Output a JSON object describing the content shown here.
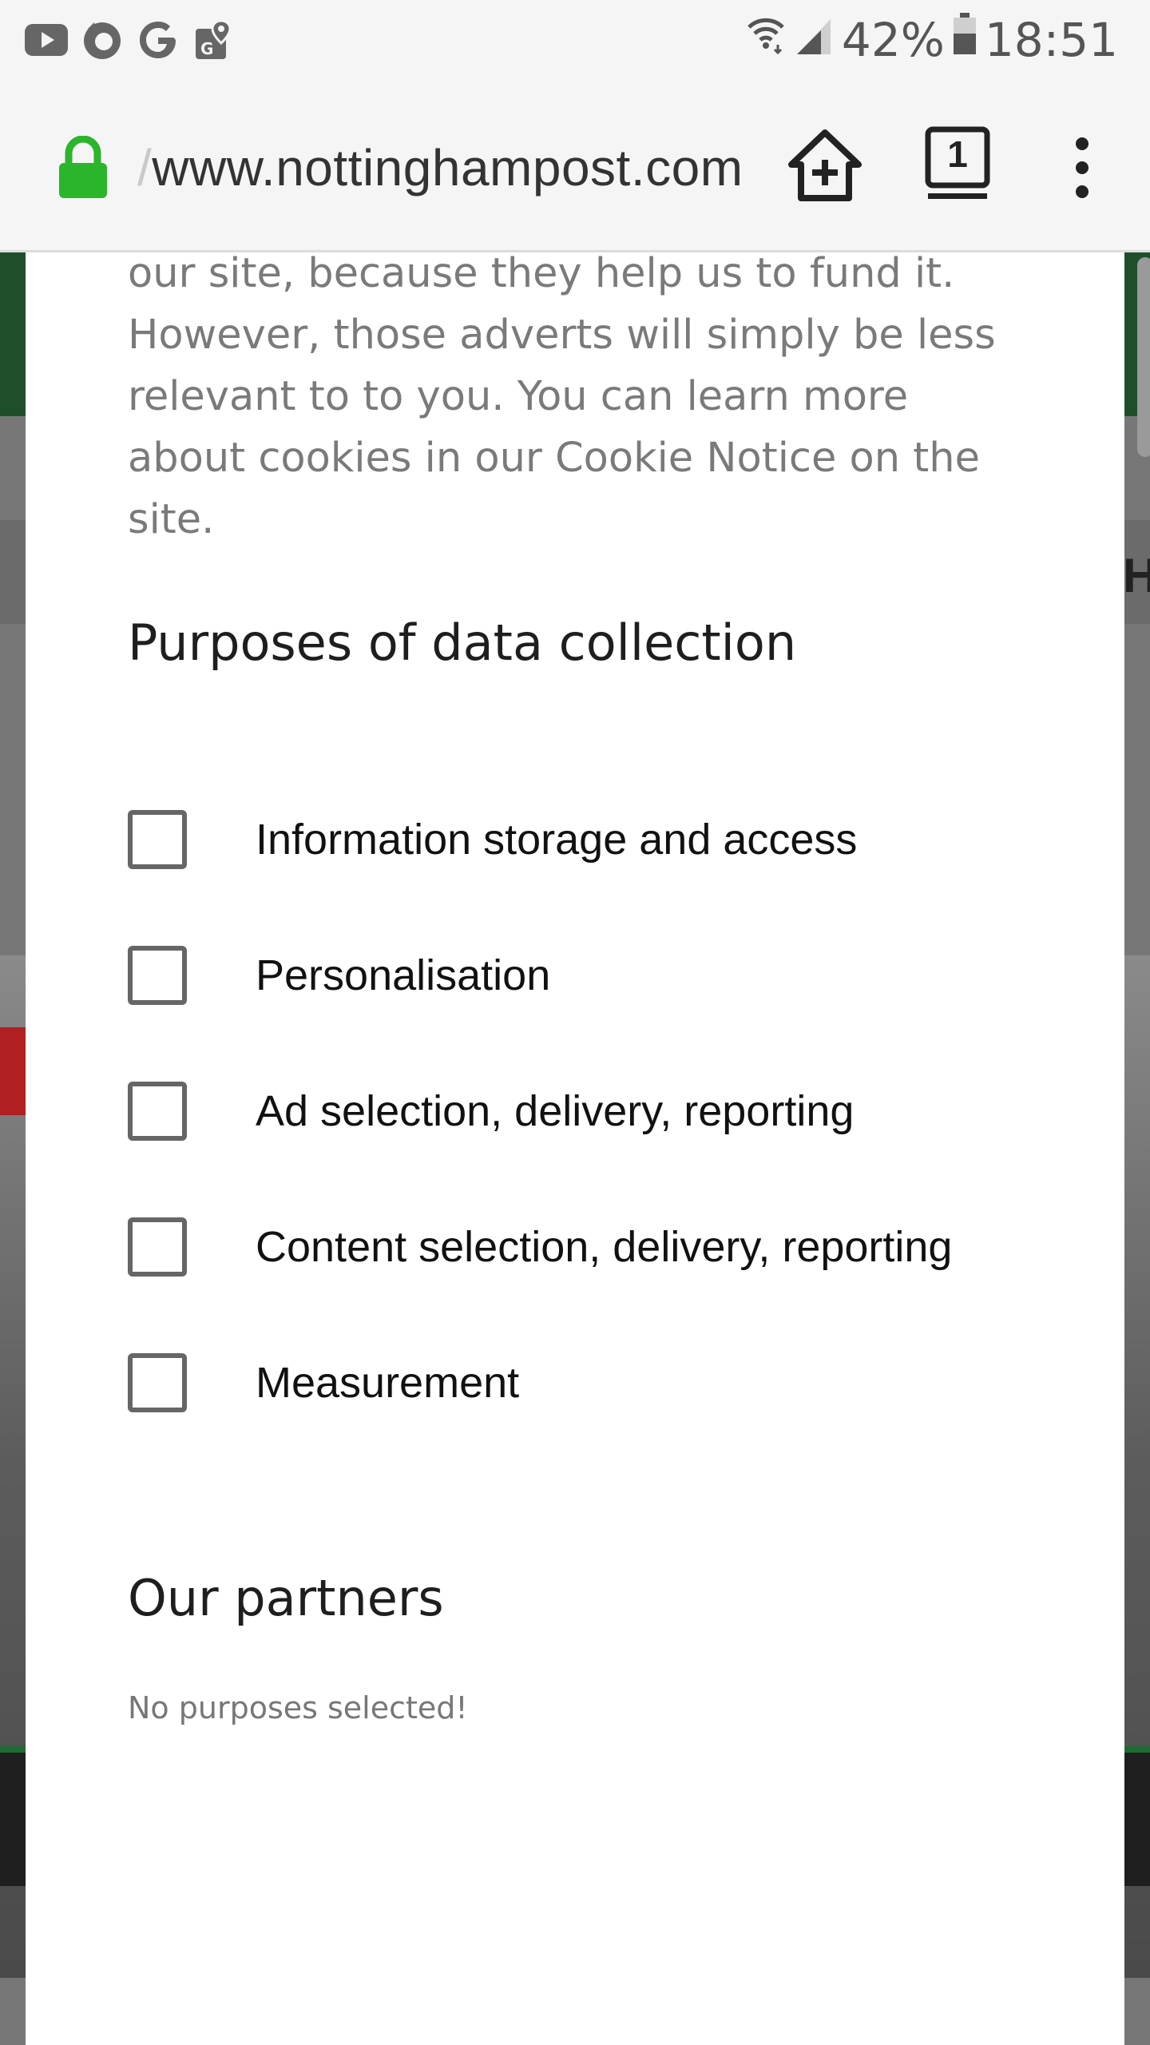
{
  "status_bar": {
    "notification_icons": [
      "youtube-icon",
      "firefox-icon",
      "google-icon",
      "maps-icon"
    ],
    "battery_percent": "42%",
    "time": "18:51"
  },
  "browser": {
    "url_prefix": "/",
    "url": "www.nottinghampost.com",
    "tab_count": "1"
  },
  "modal": {
    "intro_lines": [
      "our site, because they help us to fund it.",
      "However, those adverts will simply be less",
      "relevant to to you. You can learn more",
      "about cookies in our Cookie Notice on the",
      "site."
    ],
    "purposes_title": "Purposes of data collection",
    "purposes": [
      {
        "label": "Information storage and access",
        "checked": false
      },
      {
        "label": "Personalisation",
        "checked": false
      },
      {
        "label": "Ad selection, delivery, reporting",
        "checked": false
      },
      {
        "label": "Content selection, delivery, reporting",
        "checked": false
      },
      {
        "label": "Measurement",
        "checked": false
      }
    ],
    "partners_title": "Our partners",
    "no_purposes_text": "No purposes selected!"
  },
  "background": {
    "partial_text": "HA"
  },
  "colors": {
    "lock_green": "#2bb52b",
    "status_bar_bg": "#f5f5f5",
    "modal_bg": "#ffffff",
    "body_text": "#7a7a7a",
    "checkbox_border": "#666666"
  }
}
